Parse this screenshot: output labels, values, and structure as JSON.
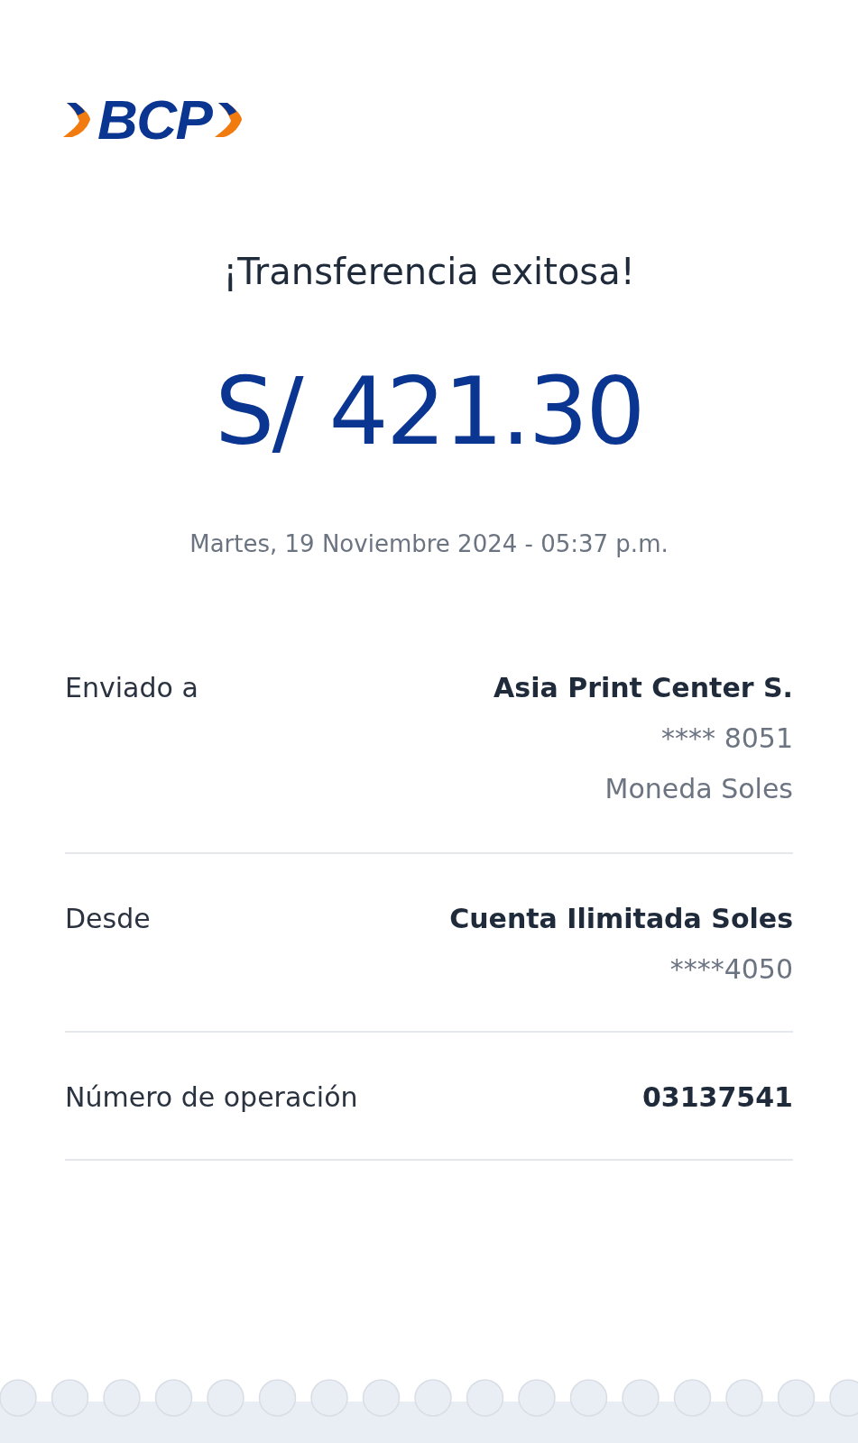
{
  "logo": {
    "text": "BCP"
  },
  "title": "¡Transferencia exitosa!",
  "amount": "S/ 421.30",
  "datetime": "Martes, 19 Noviembre 2024 - 05:37 p.m.",
  "details": [
    {
      "label": "Enviado a",
      "lines": [
        "Asia Print Center S.",
        "**** 8051",
        "Moneda Soles"
      ]
    },
    {
      "label": "Desde",
      "lines": [
        "Cuenta Ilimitada Soles",
        "****4050"
      ]
    },
    {
      "label": "Número de operación",
      "lines": [
        "03137541"
      ]
    }
  ]
}
